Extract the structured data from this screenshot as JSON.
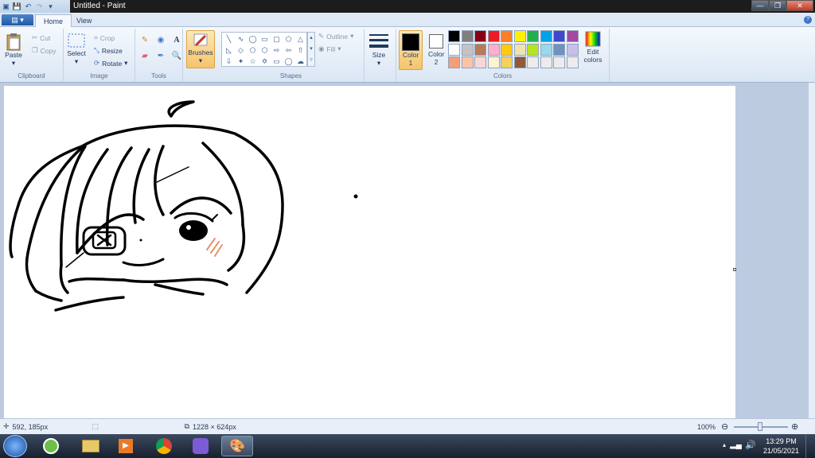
{
  "window": {
    "title": "Untitled - Paint"
  },
  "tabs": {
    "file": "",
    "home": "Home",
    "view": "View"
  },
  "clipboard": {
    "paste": "Paste",
    "cut": "Cut",
    "copy": "Copy",
    "group": "Clipboard"
  },
  "image": {
    "select": "Select",
    "crop": "Crop",
    "resize": "Resize",
    "rotate": "Rotate",
    "group": "Image"
  },
  "tools": {
    "group": "Tools"
  },
  "brushes": {
    "label": "Brushes"
  },
  "shapes": {
    "group": "Shapes",
    "outline": "Outline",
    "fill": "Fill"
  },
  "size": {
    "label": "Size"
  },
  "colors": {
    "color1": "Color 1",
    "color1_value": "#000000",
    "color2": "Color 2",
    "color2_value": "#ffffff",
    "edit": "Edit colors",
    "group": "Colors",
    "palette": [
      "#000000",
      "#7f7f7f",
      "#880015",
      "#ed1c24",
      "#ff7f27",
      "#fff200",
      "#22b14c",
      "#00a2e8",
      "#3f48cc",
      "#a349a4",
      "#ffffff",
      "#c3c3c3",
      "#b97a57",
      "#ffaec9",
      "#ffc90e",
      "#efe4b0",
      "#b5e61d",
      "#99d9ea",
      "#7092be",
      "#c8bfe7",
      "#f79d77",
      "#fbc4a9",
      "#fad7d2",
      "#fdf3d3",
      "#f4d15a",
      "#8e5a3a",
      "#ececec",
      "#ececec",
      "#ececec",
      "#ececec"
    ]
  },
  "status": {
    "cursor_pos": "592, 185px",
    "canvas_size": "1228 × 624px",
    "zoom": "100%"
  },
  "taskbar": {
    "time": "13:29 PM",
    "date": "21/05/2021"
  }
}
